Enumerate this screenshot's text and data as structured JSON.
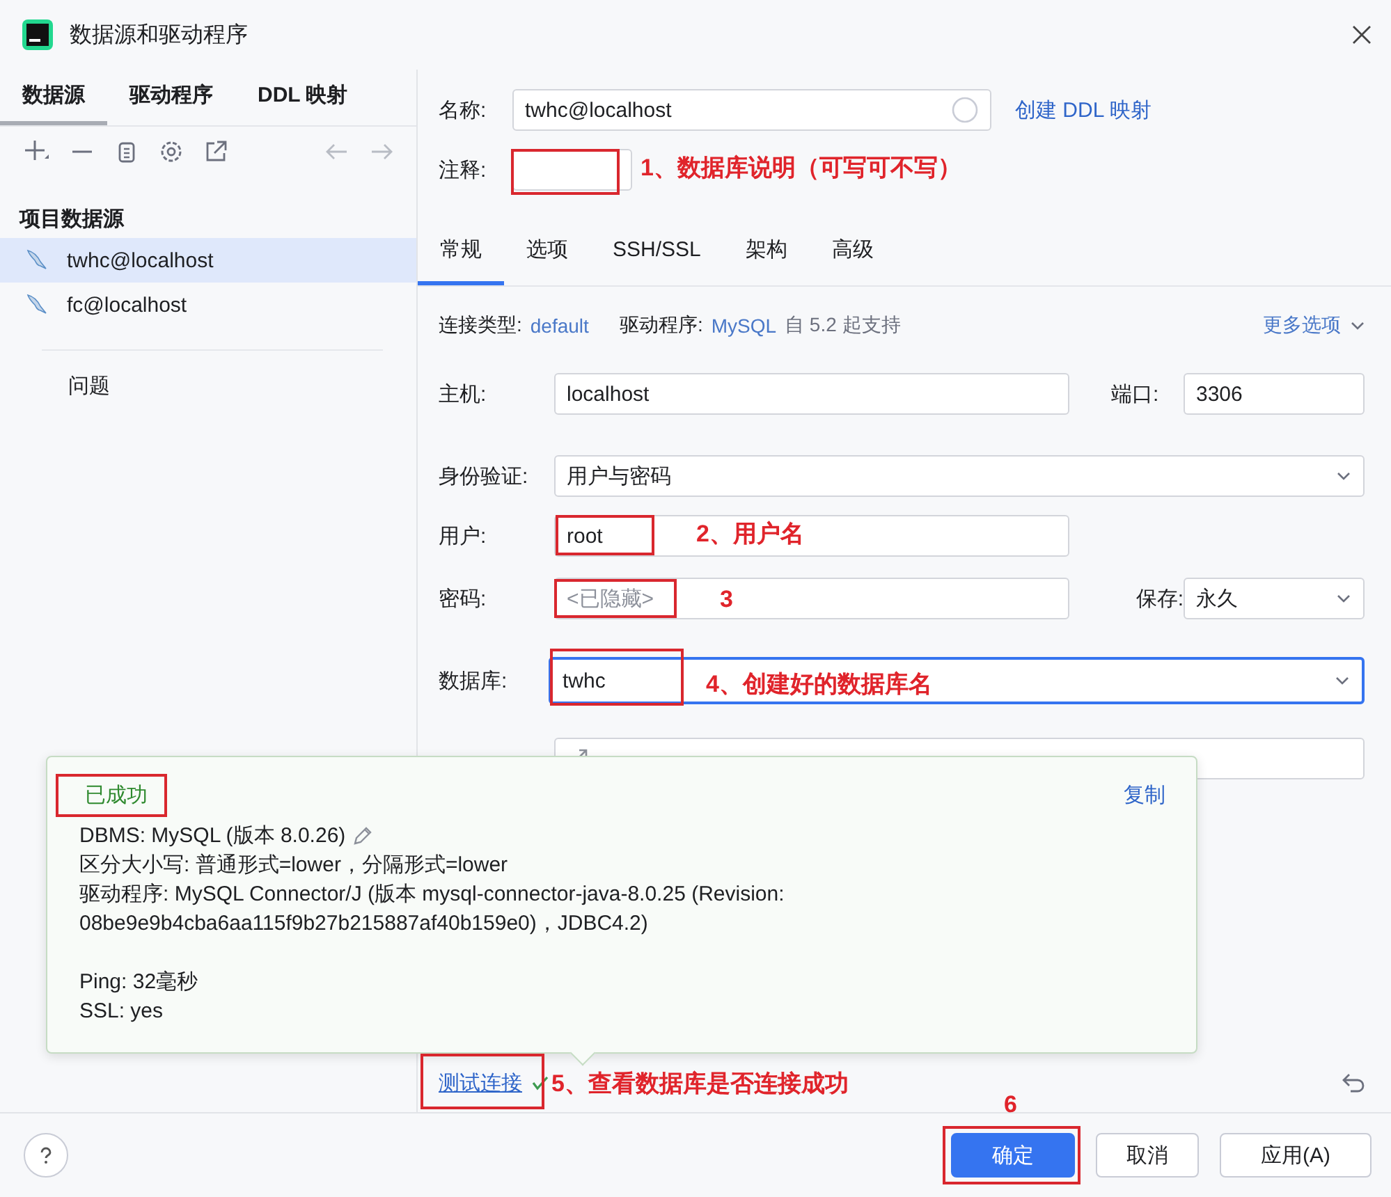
{
  "window": {
    "title": "数据源和驱动程序"
  },
  "left_tabs": [
    {
      "label": "数据源",
      "selected": true
    },
    {
      "label": "驱动程序",
      "selected": false
    },
    {
      "label": "DDL 映射",
      "selected": false
    }
  ],
  "section_title": "项目数据源",
  "data_sources": [
    {
      "name": "twhc@localhost",
      "selected": true
    },
    {
      "name": "fc@localhost",
      "selected": false
    }
  ],
  "problems": "问题",
  "name_field": {
    "label": "名称:",
    "value": "twhc@localhost"
  },
  "create_ddl_link": "创建 DDL 映射",
  "comment_field": {
    "label": "注释:"
  },
  "tabs": [
    {
      "label": "常规",
      "selected": true
    },
    {
      "label": "选项",
      "selected": false
    },
    {
      "label": "SSH/SSL",
      "selected": false
    },
    {
      "label": "架构",
      "selected": false
    },
    {
      "label": "高级",
      "selected": false
    }
  ],
  "connection_type": {
    "label": "连接类型:",
    "value": "default"
  },
  "driver": {
    "label": "驱动程序:",
    "value": "MySQL",
    "note": "自 5.2 起支持"
  },
  "more_options": "更多选项",
  "host": {
    "label": "主机:",
    "value": "localhost"
  },
  "port": {
    "label": "端口:",
    "value": "3306"
  },
  "auth": {
    "label": "身份验证:",
    "value": "用户与密码"
  },
  "user": {
    "label": "用户:",
    "value": "root"
  },
  "password": {
    "label": "密码:",
    "placeholder": "<已隐藏>"
  },
  "save": {
    "label": "保存:",
    "value": "永久"
  },
  "database": {
    "label": "数据库:",
    "value": "twhc",
    "focused": true
  },
  "popup": {
    "status": "已成功",
    "copy": "复制",
    "groups": [
      {
        "lines": [
          "DBMS: MySQL (版本 8.0.26)",
          "区分大小写: 普通形式=lower，分隔形式=lower",
          "驱动程序: MySQL Connector/J (版本 mysql-connector-java-8.0.25 (Revision: 08be9e9b4cba6aa115f9b27b215887af40b159e0)，JDBC4.2)"
        ]
      },
      {
        "lines": [
          "Ping: 32毫秒",
          "SSL: yes"
        ]
      }
    ]
  },
  "test_link": "测试连接",
  "buttons": [
    {
      "label": "确定",
      "kind": "primary"
    },
    {
      "label": "取消",
      "kind": "default"
    },
    {
      "label": "应用(A)",
      "kind": "default"
    }
  ],
  "annotations": [
    {
      "text": "1、数据库说明（可写可不写）"
    },
    {
      "text": "2、用户名"
    },
    {
      "text": "3"
    },
    {
      "text": "4、创建好的数据库名"
    },
    {
      "text": "5、查看数据库是否连接成功"
    },
    {
      "text": "6"
    }
  ]
}
